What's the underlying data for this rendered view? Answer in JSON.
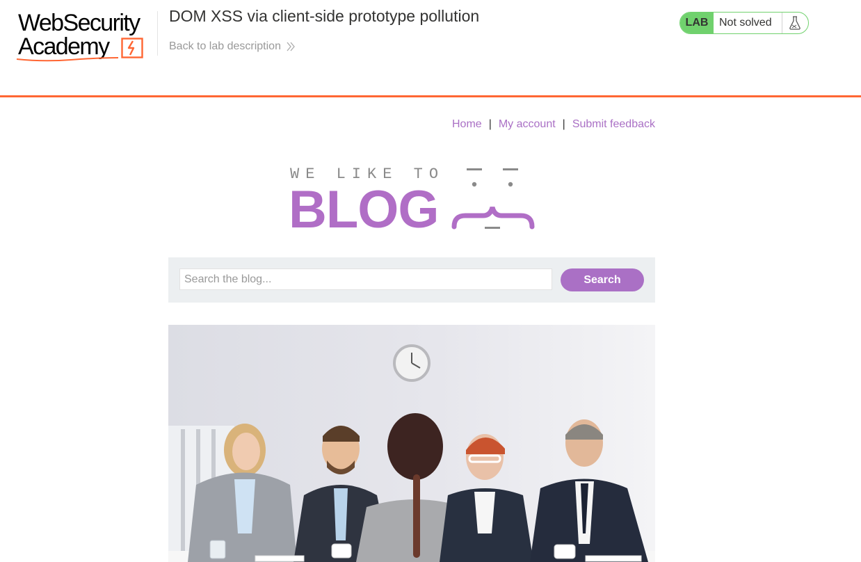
{
  "academy": {
    "logo_line1": "WebSecurity",
    "logo_line2": "Academy",
    "lab_title": "DOM XSS via client-side prototype pollution",
    "back_link": "Back to lab description",
    "lab_badge": "LAB",
    "lab_status": "Not solved",
    "flask_icon": "flask-icon"
  },
  "blog": {
    "nav": {
      "home": "Home",
      "separator": "|",
      "my_account": "My account",
      "submit_feedback": "Submit feedback"
    },
    "logo": {
      "tagline": "WE LIKE TO",
      "word": "BLOG"
    },
    "search": {
      "placeholder": "Search the blog...",
      "button": "Search"
    }
  },
  "colors": {
    "accent_orange": "#ff6633",
    "lab_green": "#70d16d",
    "blog_purple": "#aa70c5",
    "search_panel_bg": "#eceff1"
  }
}
